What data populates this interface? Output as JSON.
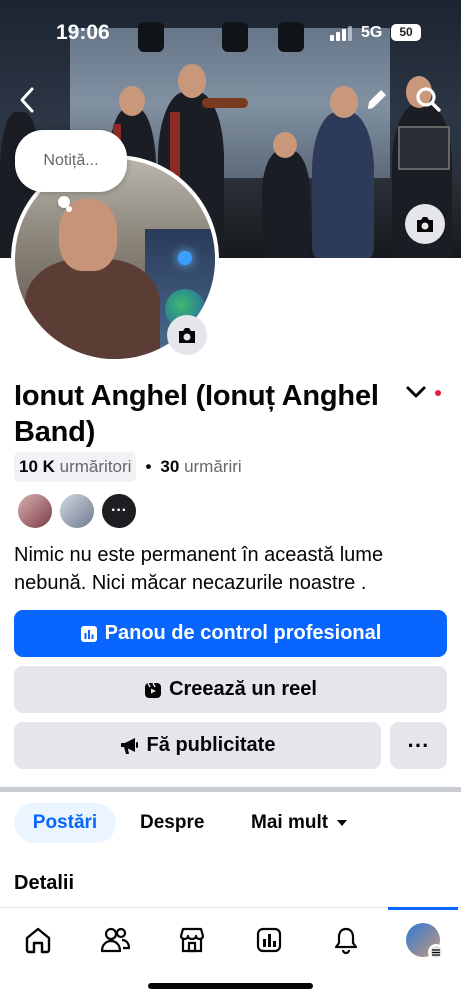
{
  "status_bar": {
    "time": "19:06",
    "network": "5G",
    "battery": "50"
  },
  "cover": {
    "back_icon": "chevron-left-icon",
    "edit_icon": "pencil-icon",
    "search_icon": "search-icon",
    "camera_icon": "camera-icon"
  },
  "note": {
    "placeholder": "Notiță..."
  },
  "profile": {
    "name": "Ionut Anghel (Ionuț Anghel Band)",
    "followers_count": "10 K",
    "followers_label": "urmăritori",
    "separator": "•",
    "following_count": "30",
    "following_label": "urmăriri",
    "more_friends": "···",
    "bio": "Nimic nu este permanent în această lume nebună. Nici măcar necazurile noastre ."
  },
  "actions": {
    "dashboard": "Panou de control profesional",
    "create_reel": "Creează un reel",
    "advertise": "Fă publicitate",
    "more": "···"
  },
  "tabs": [
    {
      "label": "Postări",
      "active": true
    },
    {
      "label": "Despre",
      "active": false
    },
    {
      "label": "Mai mult",
      "active": false
    }
  ],
  "section_title": "Detalii",
  "bottom_nav": [
    {
      "icon": "home-icon"
    },
    {
      "icon": "friends-icon"
    },
    {
      "icon": "marketplace-icon"
    },
    {
      "icon": "dashboard-icon"
    },
    {
      "icon": "bell-icon"
    },
    {
      "icon": "profile-avatar-icon",
      "active": true
    }
  ],
  "colors": {
    "primary": "#0866ff",
    "secondary_button": "#e4e6eb",
    "tab_active_bg": "#ebf5ff",
    "notification_dot": "#e41e3f"
  }
}
